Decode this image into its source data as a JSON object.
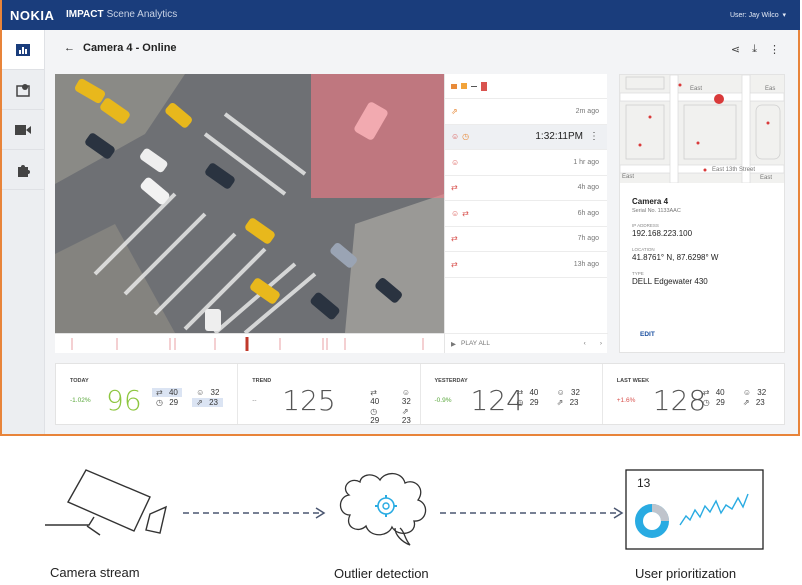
{
  "topbar": {
    "logo": "NOKIA",
    "app": "IMPACT",
    "app_sub": "Scene Analytics",
    "user": "User: Jay Wilco"
  },
  "header": {
    "title": "Camera 4 - Online"
  },
  "events": [
    {
      "time": "2m ago",
      "icons": [
        "person-walk-icon"
      ]
    },
    {
      "time": "1:32:11PM",
      "icons": [
        "face-icon",
        "clock-icon"
      ],
      "selected": true
    },
    {
      "time": "1 hr ago",
      "icons": [
        "face-icon"
      ]
    },
    {
      "time": "4h ago",
      "icons": [
        "swap-arrows-icon"
      ]
    },
    {
      "time": "6h ago",
      "icons": [
        "face-icon",
        "swap-arrows-icon"
      ]
    },
    {
      "time": "7h ago",
      "icons": [
        "swap-arrows-icon"
      ]
    },
    {
      "time": "13h ago",
      "icons": [
        "swap-arrows-icon"
      ]
    }
  ],
  "play_all": "PLAY ALL",
  "camera": {
    "name": "Camera 4",
    "serial": "Serial No. 1133AAC",
    "ip_label": "IP ADDRESS",
    "ip": "192.168.223.100",
    "loc_label": "LOCATION",
    "loc": "41.8761° N, 87.6298° W",
    "type_label": "TYPE",
    "type": "DELL Edgewater 430",
    "edit": "EDIT",
    "map_streets": [
      "East",
      "Eas",
      "East 13th Street",
      "East",
      "East"
    ]
  },
  "stats": [
    {
      "label": "TODAY",
      "delta": "-1.02%",
      "delta_color": "#5aa83c",
      "big": "96",
      "big_color": "#8dc63f",
      "m1": "40",
      "m2": "32",
      "m3": "29",
      "m4": "23"
    },
    {
      "label": "TREND",
      "delta": "--",
      "delta_color": "#888888",
      "big": "125",
      "big_color": "#555555",
      "m1": "40",
      "m2": "32",
      "m3": "29",
      "m4": "23"
    },
    {
      "label": "YESTERDAY",
      "delta": "-0.9%",
      "delta_color": "#5aa83c",
      "big": "124",
      "big_color": "#555555",
      "m1": "40",
      "m2": "32",
      "m3": "29",
      "m4": "23"
    },
    {
      "label": "LAST WEEK",
      "delta": "+1.6%",
      "delta_color": "#d9534f",
      "big": "128",
      "big_color": "#555555",
      "m1": "40",
      "m2": "32",
      "m3": "29",
      "m4": "23"
    }
  ],
  "diagram": {
    "stage1": "Camera stream",
    "stage2": "Outlier detection",
    "stage3": "User prioritization",
    "count": "13",
    "accent": "#29abe2"
  }
}
